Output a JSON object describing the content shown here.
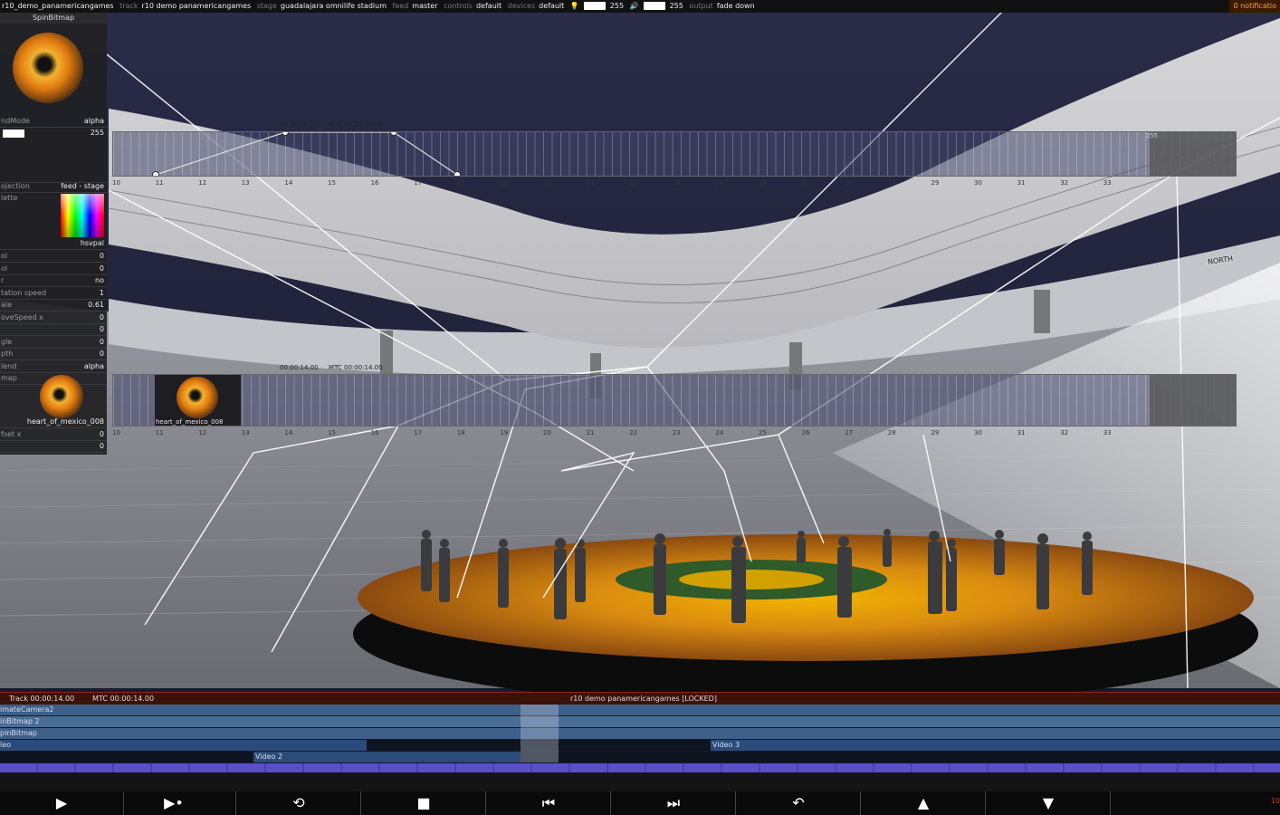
{
  "topbar": {
    "project": "r10_demo_panamericangames",
    "track_key": "track",
    "track_val": "r10 demo panamericangames",
    "stage_key": "stage",
    "stage_val": "guadalajara omnilife stadium",
    "feed_key": "feed",
    "feed_val": "master",
    "controls_key": "controls",
    "controls_val": "default",
    "devices_key": "devices",
    "devices_val": "default",
    "light_level": "255",
    "volume_level": "255",
    "output_key": "output",
    "output_val": "fade down",
    "notifications": "0 notificatio"
  },
  "panel": {
    "title": "SpinBitmap",
    "blend_label": "ndMode",
    "blend_value": "alpha",
    "level_value": "255",
    "projection_label": "ojection",
    "projection_value": "feed - stage",
    "palette_label": "lette",
    "palette_value": "hsvpal",
    "rows": [
      {
        "label": "ol",
        "value": "0"
      },
      {
        "label": "ol",
        "value": "0"
      },
      {
        "label": "r",
        "value": "no"
      },
      {
        "label": "tation speed",
        "value": "1"
      },
      {
        "label": "ale",
        "value": "0.61"
      },
      {
        "label": "oveSpeed x",
        "value": "0"
      },
      {
        "label": "",
        "value": "0"
      },
      {
        "label": "gle",
        "value": "0"
      },
      {
        "label": "pth",
        "value": "0"
      },
      {
        "label": "lend",
        "value": "alpha"
      },
      {
        "label": "map",
        "value": ""
      }
    ],
    "bitmap_name": "heart_of_mexico_008",
    "tail_rows": [
      {
        "label": "fset x",
        "value": "0"
      },
      {
        "label": "",
        "value": "0"
      }
    ]
  },
  "timeline1": {
    "cursor_time": "00:00:14.00",
    "mtc": "MTC 00:00:14.00",
    "end_value": "255"
  },
  "timeline2": {
    "cursor_time": "00:00:14.00",
    "mtc": "MTC 00:00:14.00",
    "clip_name": "heart_of_mexico_008"
  },
  "ticks": [
    "10",
    "11",
    "12",
    "13",
    "14",
    "15",
    "16",
    "17",
    "18",
    "19",
    "20",
    "21",
    "22",
    "23",
    "24",
    "25",
    "26",
    "27",
    "28",
    "29",
    "30",
    "31",
    "32",
    "33"
  ],
  "scene": {
    "sign": "NORTH"
  },
  "status": {
    "track": "Track 00:00:14.00",
    "mtc": "MTC 00:00:14.00",
    "center": "r10 demo panamericangames [LOCKED]"
  },
  "tracks": [
    {
      "name": "imateCamera2"
    },
    {
      "name": "inBitmap 2"
    },
    {
      "name": "pinBitmap"
    },
    {
      "name": "leo"
    },
    {
      "name": "Video 2"
    },
    {
      "name": "Video 3"
    }
  ],
  "transport": {
    "play": "▶",
    "play_from": "▶•",
    "loop": "⟲",
    "stop": "■",
    "prev": "⏮",
    "next": "⏭",
    "undo": "↶",
    "up": "▲",
    "down": "▼",
    "rec": "10"
  },
  "colors": {
    "accent_orange": "#f5a35a",
    "status_red": "#3b1208",
    "track_blue": "#3d5f8a",
    "clip_blue": "#2b4c7a"
  }
}
